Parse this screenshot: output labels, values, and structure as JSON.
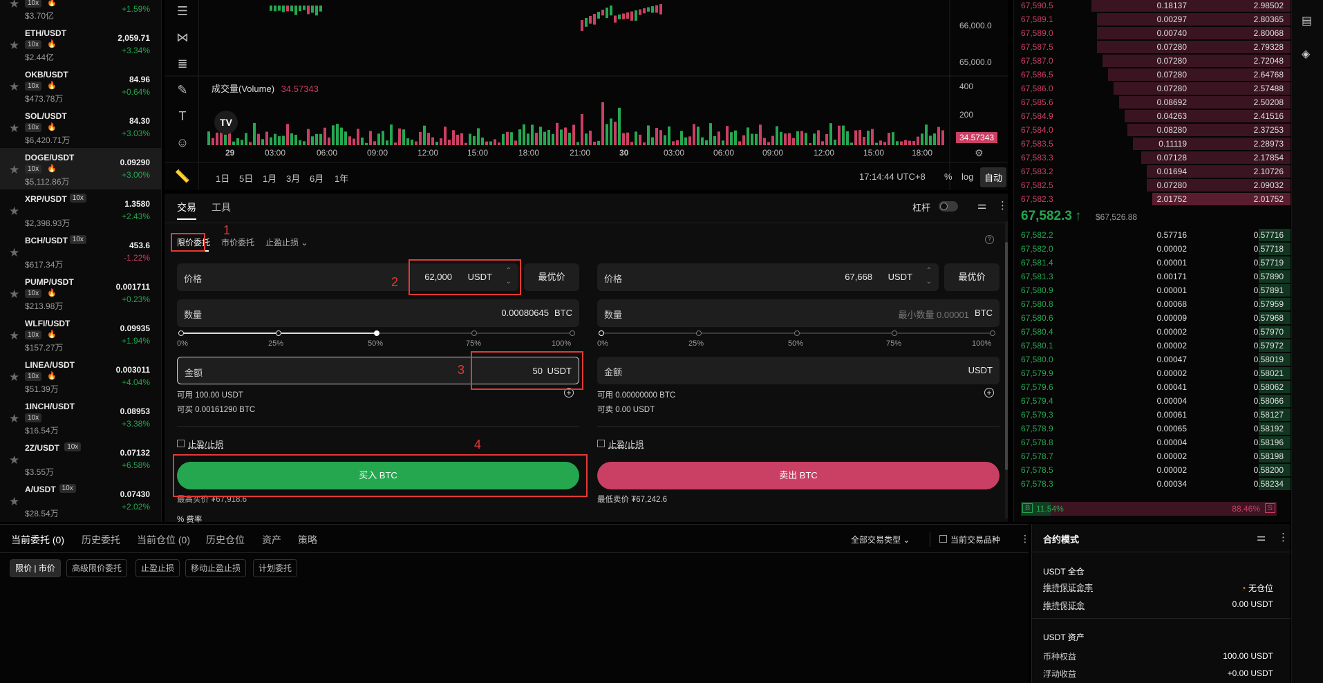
{
  "markets": [
    {
      "pair": "",
      "lev": "10x",
      "hot": true,
      "vol": "$3.70亿",
      "price": "",
      "chg": "+1.59%",
      "up": true
    },
    {
      "pair": "ETH/USDT",
      "lev": "10x",
      "hot": true,
      "vol": "$2.44亿",
      "price": "2,059.71",
      "chg": "+3.34%",
      "up": true
    },
    {
      "pair": "OKB/USDT",
      "lev": "10x",
      "hot": true,
      "vol": "$473.78万",
      "price": "84.96",
      "chg": "+0.64%",
      "up": true
    },
    {
      "pair": "SOL/USDT",
      "lev": "10x",
      "hot": true,
      "vol": "$6,420.71万",
      "price": "84.30",
      "chg": "+3.03%",
      "up": true
    },
    {
      "pair": "DOGE/USDT",
      "lev": "10x",
      "hot": true,
      "vol": "$5,112.86万",
      "price": "0.09290",
      "chg": "+3.00%",
      "up": true,
      "selected": true
    },
    {
      "pair": "XRP/USDT",
      "lev": "10x",
      "hot": false,
      "inline": true,
      "vol": "$2,398.93万",
      "price": "1.3580",
      "chg": "+2.43%",
      "up": true
    },
    {
      "pair": "BCH/USDT",
      "lev": "10x",
      "hot": false,
      "inline": true,
      "vol": "$617.34万",
      "price": "453.6",
      "chg": "-1.22%",
      "up": false
    },
    {
      "pair": "PUMP/USDT",
      "lev": "10x",
      "hot": true,
      "vol": "$213.98万",
      "price": "0.001711",
      "chg": "+0.23%",
      "up": true
    },
    {
      "pair": "WLFI/USDT",
      "lev": "10x",
      "hot": true,
      "vol": "$157.27万",
      "price": "0.09935",
      "chg": "+1.94%",
      "up": true
    },
    {
      "pair": "LINEA/USDT",
      "lev": "10x",
      "hot": true,
      "vol": "$51.39万",
      "price": "0.003011",
      "chg": "+4.04%",
      "up": true
    },
    {
      "pair": "1INCH/USDT",
      "lev": "10x",
      "hot": false,
      "vol": "$16.54万",
      "price": "0.08953",
      "chg": "+3.38%",
      "up": true
    },
    {
      "pair": "2Z/USDT",
      "lev": "10x",
      "hot": false,
      "inline": true,
      "vol": "$3.55万",
      "price": "0.07132",
      "chg": "+6.58%",
      "up": true
    },
    {
      "pair": "A/USDT",
      "lev": "10x",
      "hot": false,
      "inline": true,
      "vol": "$28.54万",
      "price": "0.07430",
      "chg": "+2.02%",
      "up": true
    }
  ],
  "chart": {
    "y_labels": [
      "66,000.0",
      "65,000.0",
      "400",
      "200"
    ],
    "volume_label": "成交量(Volume)",
    "volume_value": "34.57343",
    "volume_tag": "34.57343",
    "x_labels": [
      "29",
      "03:00",
      "06:00",
      "09:00",
      "12:00",
      "15:00",
      "18:00",
      "21:00",
      "30",
      "03:00",
      "06:00",
      "09:00",
      "12:00",
      "15:00",
      "18:00"
    ],
    "ranges": [
      "1日",
      "5日",
      "1月",
      "3月",
      "6月",
      "1年"
    ],
    "time": "17:14:44 UTC+8",
    "pct": "%",
    "log": "log",
    "auto": "自动"
  },
  "trade": {
    "tabs": [
      "交易",
      "工具"
    ],
    "leverage": "杠杆",
    "order_types": [
      "限价委托",
      "市价委托",
      "止盈止损"
    ],
    "buy": {
      "price_label": "价格",
      "price": "62,000",
      "price_unit": "USDT",
      "best": "最优价",
      "qty_label": "数量",
      "qty": "0.00080645",
      "qty_unit": "BTC",
      "pcts": [
        "0%",
        "25%",
        "50%",
        "75%",
        "100%"
      ],
      "amount_label": "金额",
      "amount": "50",
      "amount_unit": "USDT",
      "avail": "可用 100.00 USDT",
      "canbuy": "可买 0.00161290 BTC",
      "tpsl": "止盈/止损",
      "button": "买入 BTC",
      "ref": "最高买价 ₮67,918.6"
    },
    "sell": {
      "price_label": "价格",
      "price": "67,668",
      "price_unit": "USDT",
      "best": "最优价",
      "qty_label": "数量",
      "qty_placeholder": "最小数量 0.00001",
      "qty_unit": "BTC",
      "pcts": [
        "0%",
        "25%",
        "50%",
        "75%",
        "100%"
      ],
      "amount_label": "金额",
      "amount_unit": "USDT",
      "avail": "可用 0.00000000 BTC",
      "cansell": "可卖 0.00 USDT",
      "tpsl": "止盈/止损",
      "button": "卖出 BTC",
      "ref": "最低卖价 ₮67,242.6"
    },
    "fee": "费率",
    "annotations": [
      "1",
      "2",
      "3",
      "4"
    ]
  },
  "orderbook": {
    "asks": [
      [
        "67,590.5",
        "0.18137",
        "2.98502"
      ],
      [
        "67,589.1",
        "0.00297",
        "2.80365"
      ],
      [
        "67,589.0",
        "0.00740",
        "2.80068"
      ],
      [
        "67,587.5",
        "0.07280",
        "2.79328"
      ],
      [
        "67,587.0",
        "0.07280",
        "2.72048"
      ],
      [
        "67,586.5",
        "0.07280",
        "2.64768"
      ],
      [
        "67,586.0",
        "0.07280",
        "2.57488"
      ],
      [
        "67,585.6",
        "0.08692",
        "2.50208"
      ],
      [
        "67,584.9",
        "0.04263",
        "2.41516"
      ],
      [
        "67,584.0",
        "0.08280",
        "2.37253"
      ],
      [
        "67,583.5",
        "0.11119",
        "2.28973"
      ],
      [
        "67,583.3",
        "0.07128",
        "2.17854"
      ],
      [
        "67,583.2",
        "0.01694",
        "2.10726"
      ],
      [
        "67,582.5",
        "0.07280",
        "2.09032"
      ],
      [
        "67,582.3",
        "2.01752",
        "2.01752"
      ]
    ],
    "ask_depth": [
      0.72,
      0.7,
      0.7,
      0.7,
      0.68,
      0.66,
      0.64,
      0.62,
      0.6,
      0.59,
      0.57,
      0.54,
      0.52,
      0.52,
      0.5
    ],
    "mid": "67,582.3",
    "mid_arrow": "↑",
    "mid_ref": "$67,526.88",
    "bids": [
      [
        "67,582.2",
        "0.57716",
        "0.57716"
      ],
      [
        "67,582.0",
        "0.00002",
        "0.57718"
      ],
      [
        "67,581.4",
        "0.00001",
        "0.57719"
      ],
      [
        "67,581.3",
        "0.00171",
        "0.57890"
      ],
      [
        "67,580.9",
        "0.00001",
        "0.57891"
      ],
      [
        "67,580.8",
        "0.00068",
        "0.57959"
      ],
      [
        "67,580.6",
        "0.00009",
        "0.57968"
      ],
      [
        "67,580.4",
        "0.00002",
        "0.57970"
      ],
      [
        "67,580.1",
        "0.00002",
        "0.57972"
      ],
      [
        "67,580.0",
        "0.00047",
        "0.58019"
      ],
      [
        "67,579.9",
        "0.00002",
        "0.58021"
      ],
      [
        "67,579.6",
        "0.00041",
        "0.58062"
      ],
      [
        "67,579.4",
        "0.00004",
        "0.58066"
      ],
      [
        "67,579.3",
        "0.00061",
        "0.58127"
      ],
      [
        "67,578.9",
        "0.00065",
        "0.58192"
      ],
      [
        "67,578.8",
        "0.00004",
        "0.58196"
      ],
      [
        "67,578.7",
        "0.00002",
        "0.58198"
      ],
      [
        "67,578.5",
        "0.00002",
        "0.58200"
      ],
      [
        "67,578.3",
        "0.00034",
        "0.58234"
      ]
    ],
    "bid_depth": 0.115,
    "b_label": "B",
    "b_pct": "11.54%",
    "s_pct": "88.46%",
    "s_label": "S",
    "b_ratio": 0.1154
  },
  "bottom": {
    "tabs": [
      "当前委托 (0)",
      "历史委托",
      "当前仓位 (0)",
      "历史仓位",
      "资产",
      "策略"
    ],
    "filter": "全部交易类型",
    "current_only": "当前交易品种",
    "chips": [
      "限价 | 市价",
      "高级限价委托",
      "止盈止损",
      "移动止盈止损",
      "计划委托"
    ]
  },
  "contract": {
    "title": "合约模式",
    "usdt_all": "USDT 全仓",
    "mmr_label": "维持保证金率",
    "mmr_value": "无仓位",
    "mm_label": "维持保证金",
    "mm_value": "0.00 USDT",
    "assets_title": "USDT 资产",
    "equity_label": "币种权益",
    "equity_value": "100.00 USDT",
    "pnl_label": "浮动收益",
    "pnl_value": "+0.00 USDT"
  },
  "colors": {
    "buy": "#25a750",
    "sell": "#ca3f64",
    "annotation": "#e53935"
  }
}
